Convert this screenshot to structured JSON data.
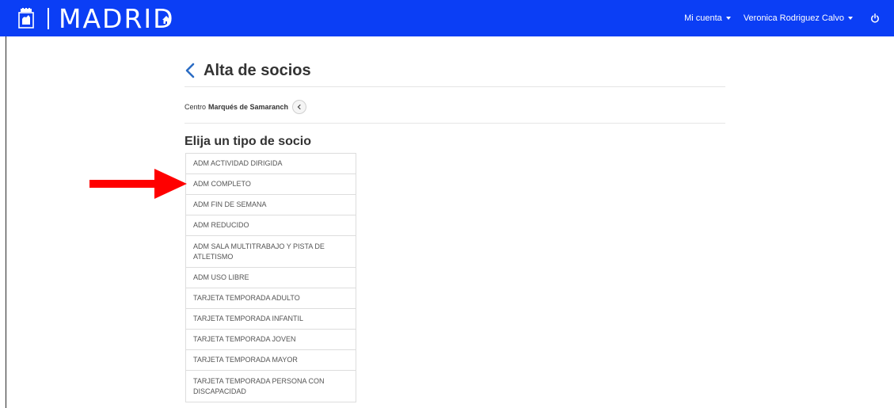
{
  "header": {
    "brand": "MADRID",
    "account_menu_label": "Mi cuenta",
    "user_menu_label": "Veronica Rodriguez Calvo",
    "brand_color": "#0b3ef5"
  },
  "page": {
    "title": "Alta de socios",
    "centro_label": "Centro",
    "centro_name": "Marqués de Samaranch",
    "subtitle": "Elija un tipo de socio"
  },
  "member_types": [
    "ADM ACTIVIDAD DIRIGIDA",
    "ADM COMPLETO",
    "ADM FIN DE SEMANA",
    "ADM REDUCIDO",
    "ADM SALA MULTITRABAJO Y PISTA DE ATLETISMO",
    "ADM USO LIBRE",
    "TARJETA TEMPORADA ADULTO",
    "TARJETA TEMPORADA INFANTIL",
    "TARJETA TEMPORADA JOVEN",
    "TARJETA TEMPORADA MAYOR",
    "TARJETA TEMPORADA PERSONA CON DISCAPACIDAD"
  ],
  "annotation": {
    "arrow_color": "#ff0000",
    "points_to": "ADM COMPLETO"
  },
  "icons": {
    "crest": "madrid-crest-icon",
    "home": "home-icon",
    "power": "power-icon",
    "back": "chevron-left-icon",
    "centro_change": "chevron-left-icon"
  }
}
